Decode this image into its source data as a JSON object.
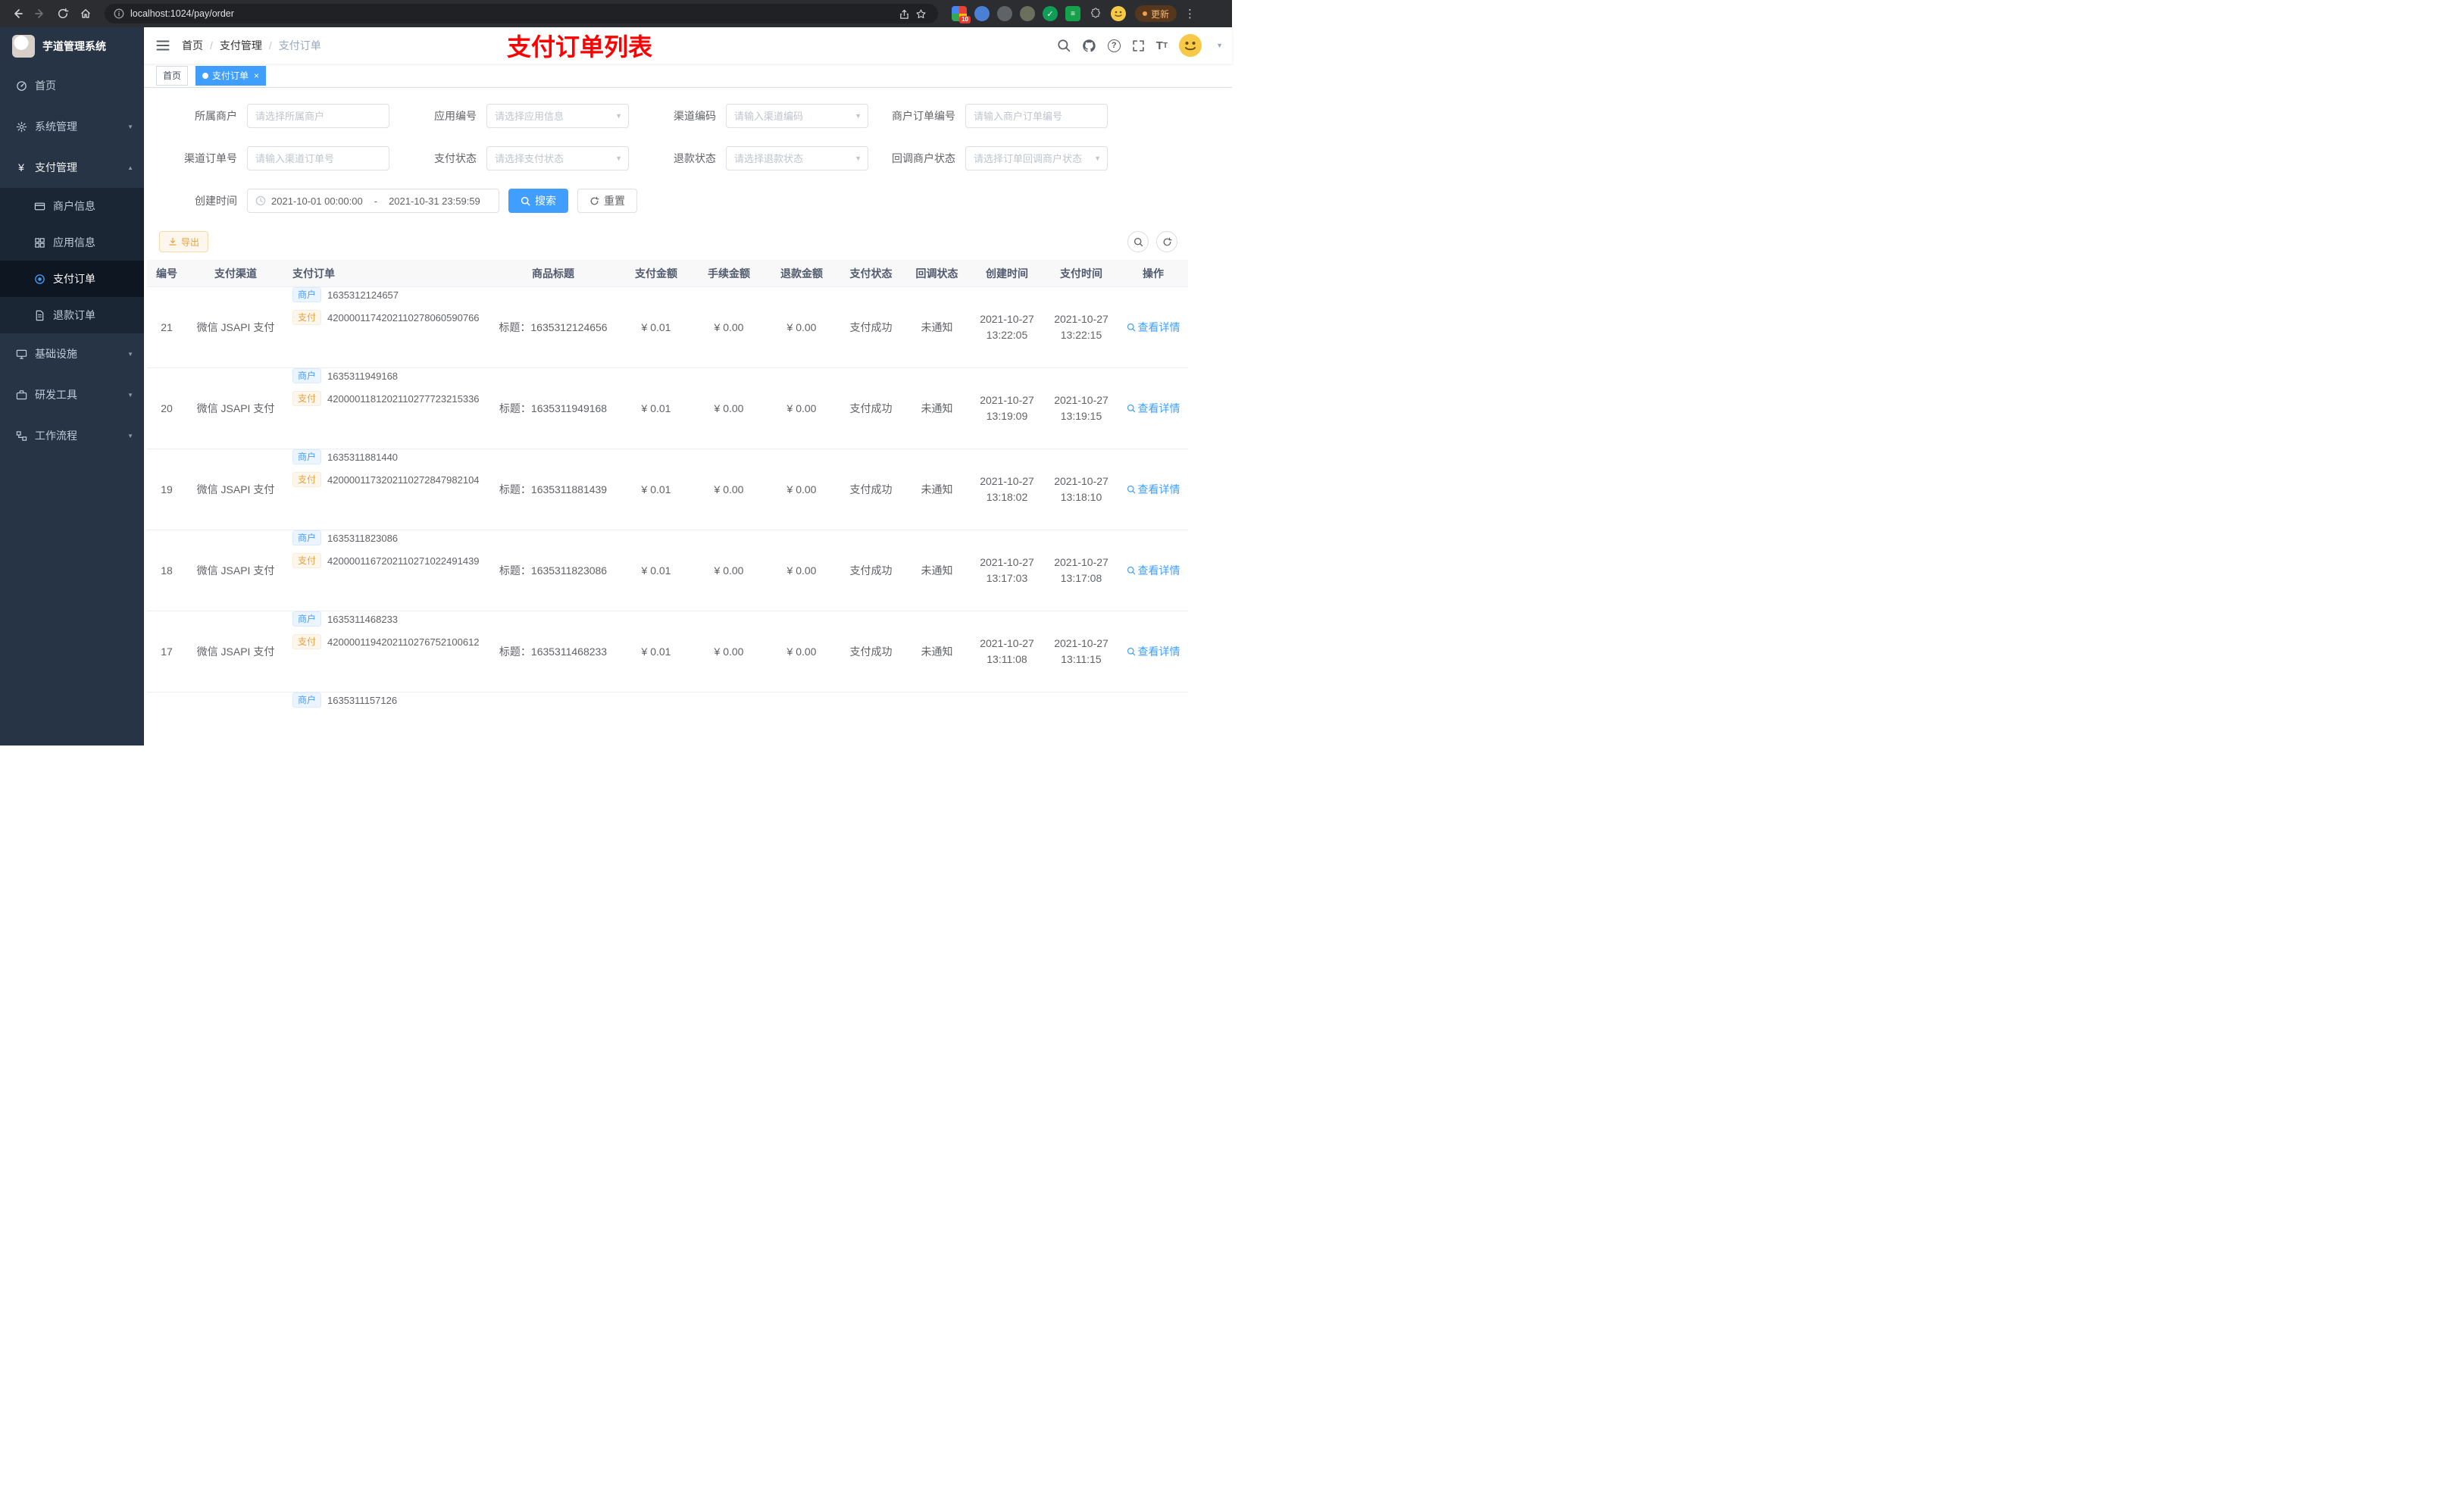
{
  "browser": {
    "url": "localhost:1024/pay/order",
    "update_label": "更新",
    "extensions_badge": "10"
  },
  "sidebar": {
    "title": "芋道管理系统",
    "menu": [
      {
        "label": "首页"
      },
      {
        "label": "系统管理"
      },
      {
        "label": "支付管理"
      },
      {
        "label": "基础设施"
      },
      {
        "label": "研发工具"
      },
      {
        "label": "工作流程"
      }
    ],
    "submenu": [
      {
        "label": "商户信息"
      },
      {
        "label": "应用信息"
      },
      {
        "label": "支付订单"
      },
      {
        "label": "退款订单"
      }
    ]
  },
  "header": {
    "breadcrumb": [
      "首页",
      "支付管理",
      "支付订单"
    ],
    "annotation": "支付订单列表"
  },
  "tabs": [
    {
      "label": "首页"
    },
    {
      "label": "支付订单"
    }
  ],
  "filters": {
    "fields": [
      {
        "label": "所属商户",
        "placeholder": "请选择所属商户"
      },
      {
        "label": "应用编号",
        "placeholder": "请选择应用信息"
      },
      {
        "label": "渠道编码",
        "placeholder": "请输入渠道编码"
      },
      {
        "label": "商户订单编号",
        "placeholder": "请输入商户订单编号"
      },
      {
        "label": "渠道订单号",
        "placeholder": "请输入渠道订单号"
      },
      {
        "label": "支付状态",
        "placeholder": "请选择支付状态"
      },
      {
        "label": "退款状态",
        "placeholder": "请选择退款状态"
      },
      {
        "label": "回调商户状态",
        "placeholder": "请选择订单回调商户状态"
      }
    ],
    "date_label": "创建时间",
    "date_start": "2021-10-01 00:00:00",
    "date_end": "2021-10-31 23:59:59",
    "search_label": "搜索",
    "reset_label": "重置"
  },
  "toolbar": {
    "export_label": "导出"
  },
  "table": {
    "columns": [
      "编号",
      "支付渠道",
      "支付订单",
      "商品标题",
      "支付金额",
      "手续金额",
      "退款金额",
      "支付状态",
      "回调状态",
      "创建时间",
      "支付时间",
      "操作"
    ],
    "merchant_tag": "商户",
    "pay_tag": "支付",
    "action_label": "查看详情",
    "rows": [
      {
        "id": "21",
        "channel": "微信 JSAPI 支付",
        "merchant_no": "1635312124657",
        "pay_no": "4200001174202110278060590766",
        "title": "标题：1635312124656",
        "amount": "¥ 0.01",
        "fee": "¥ 0.00",
        "refund": "¥ 0.00",
        "status": "支付成功",
        "notify": "未通知",
        "created_date": "2021-10-27",
        "created_time": "13:22:05",
        "paid_date": "2021-10-27",
        "paid_time": "13:22:15"
      },
      {
        "id": "20",
        "channel": "微信 JSAPI 支付",
        "merchant_no": "1635311949168",
        "pay_no": "4200001181202110277723215336",
        "title": "标题：1635311949168",
        "amount": "¥ 0.01",
        "fee": "¥ 0.00",
        "refund": "¥ 0.00",
        "status": "支付成功",
        "notify": "未通知",
        "created_date": "2021-10-27",
        "created_time": "13:19:09",
        "paid_date": "2021-10-27",
        "paid_time": "13:19:15"
      },
      {
        "id": "19",
        "channel": "微信 JSAPI 支付",
        "merchant_no": "1635311881440",
        "pay_no": "4200001173202110272847982104",
        "title": "标题：1635311881439",
        "amount": "¥ 0.01",
        "fee": "¥ 0.00",
        "refund": "¥ 0.00",
        "status": "支付成功",
        "notify": "未通知",
        "created_date": "2021-10-27",
        "created_time": "13:18:02",
        "paid_date": "2021-10-27",
        "paid_time": "13:18:10"
      },
      {
        "id": "18",
        "channel": "微信 JSAPI 支付",
        "merchant_no": "1635311823086",
        "pay_no": "4200001167202110271022491439",
        "title": "标题：1635311823086",
        "amount": "¥ 0.01",
        "fee": "¥ 0.00",
        "refund": "¥ 0.00",
        "status": "支付成功",
        "notify": "未通知",
        "created_date": "2021-10-27",
        "created_time": "13:17:03",
        "paid_date": "2021-10-27",
        "paid_time": "13:17:08"
      },
      {
        "id": "17",
        "channel": "微信 JSAPI 支付",
        "merchant_no": "1635311468233",
        "pay_no": "4200001194202110276752100612",
        "title": "标题：1635311468233",
        "amount": "¥ 0.01",
        "fee": "¥ 0.00",
        "refund": "¥ 0.00",
        "status": "支付成功",
        "notify": "未通知",
        "created_date": "2021-10-27",
        "created_time": "13:11:08",
        "paid_date": "2021-10-27",
        "paid_time": "13:11:15"
      },
      {
        "id": "",
        "channel": "",
        "merchant_no": "1635311157126",
        "pay_no": "",
        "title": "",
        "amount": "",
        "fee": "",
        "refund": "",
        "status": "",
        "notify": "",
        "created_date": "",
        "created_time": "",
        "paid_date": "",
        "paid_time": "",
        "partial": true
      }
    ]
  },
  "colors": {
    "accent": "#409eff",
    "warning": "#e6a23c",
    "annotation_red": "#ff0000",
    "sidebar_bg": "#273445"
  }
}
